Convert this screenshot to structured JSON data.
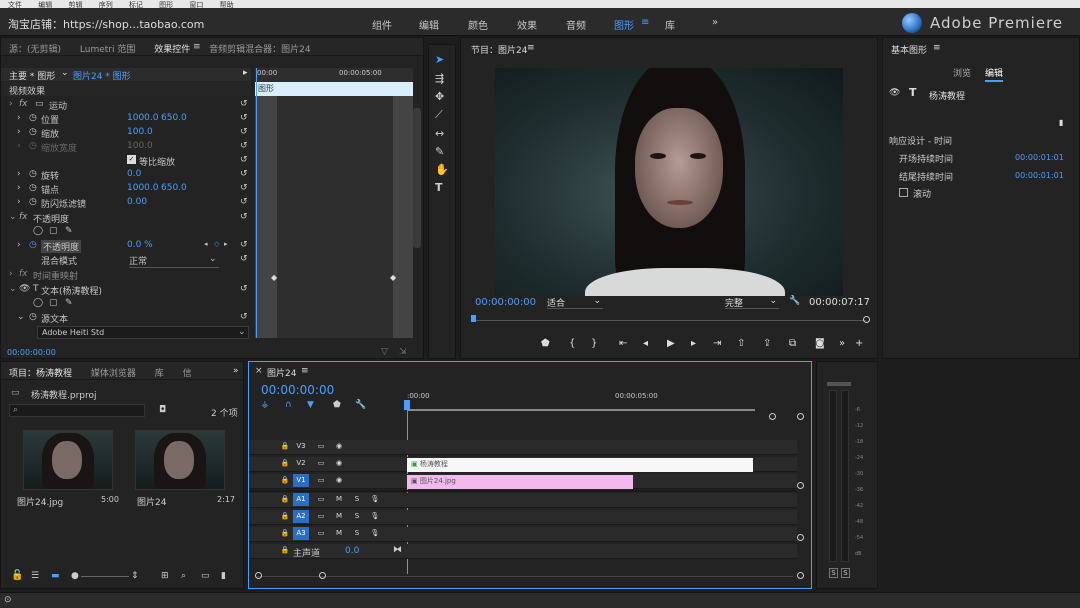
{
  "menubar": [
    "文件",
    "编辑",
    "剪辑",
    "序列",
    "标记",
    "图形",
    "窗口",
    "帮助"
  ],
  "topbar": {
    "shop_label": "淘宝店铺：https://shop...taobao.com",
    "workspaces": [
      {
        "label": "组件",
        "active": false
      },
      {
        "label": "编辑",
        "active": false
      },
      {
        "label": "颜色",
        "active": false
      },
      {
        "label": "效果",
        "active": false
      },
      {
        "label": "音频",
        "active": false
      },
      {
        "label": "图形",
        "active": true
      },
      {
        "label": "库",
        "active": false
      }
    ],
    "more": "»",
    "menu_icon": "≡",
    "logo_text": "Adobe Premiere"
  },
  "source_panel": {
    "tabs": [
      "源：(无剪辑)",
      "Lumetri 范围",
      "效果控件",
      "音频剪辑混合器：图片24"
    ],
    "active_tab": "效果控件",
    "menu_icon": "≡",
    "clip_master": "主要 * 图形",
    "clip_name": "图片24 * 图形",
    "timecode_start": "00:00",
    "timecode_end": "00:00:05:00",
    "clip_bar_label": "图形",
    "section_video": "视频效果",
    "rows": [
      {
        "label": "运动",
        "fx": true
      },
      {
        "label": "位置",
        "v1": "1000.0",
        "v2": "650.0"
      },
      {
        "label": "缩放",
        "v1": "100.0"
      },
      {
        "label": "缩放宽度",
        "v1": "100.0",
        "dim": true
      },
      {
        "label": "等比缩放",
        "checkbox": true
      },
      {
        "label": "旋转",
        "v1": "0.0"
      },
      {
        "label": "锚点",
        "v1": "1000.0",
        "v2": "650.0"
      },
      {
        "label": "防闪烁滤镜",
        "v1": "0.00"
      },
      {
        "label": "不透明度",
        "fx": true
      },
      {
        "label": "不透明度",
        "v1": "0.0 %",
        "highlight": true
      },
      {
        "label": "混合模式",
        "select": "正常"
      },
      {
        "label": "时间重映射",
        "fx": true
      },
      {
        "label": "文本(杨涛教程)",
        "fx": true
      },
      {
        "label": "源文本"
      }
    ],
    "font_select": "Adobe Heiti Std",
    "bottom_timecode": "00:00:00:00"
  },
  "program_panel": {
    "title": "节目：图片24",
    "menu_icon": "≡",
    "timecode_left": "00:00:00:00",
    "fit_select": "适合",
    "quality_select": "完整",
    "timecode_right": "00:00:07:17"
  },
  "graphics_panel": {
    "title": "基本图形",
    "menu_icon": "≡",
    "tabs": [
      "浏览",
      "编辑"
    ],
    "active_tab": "编辑",
    "layer_name": "杨涛教程",
    "responsive_title": "响应设计 - 时间",
    "intro_label": "开场持续时间",
    "intro_value": "00:00:01:01",
    "outro_label": "结尾持续时间",
    "outro_value": "00:00:01:01",
    "roll_label": "滚动"
  },
  "project_panel": {
    "tabs": [
      "项目：杨涛教程",
      "媒体浏览器",
      "库",
      "信"
    ],
    "active_tab": "项目：杨涛教程",
    "menu_icon": "≡",
    "more": "»",
    "file": "杨涛教程.prproj",
    "item_count": "2 个项",
    "items": [
      {
        "name": "图片24.jpg",
        "duration": "5:00"
      },
      {
        "name": "图片24",
        "duration": "2:17"
      }
    ]
  },
  "timeline_panel": {
    "title": "图片24",
    "close": "×",
    "menu_icon": "≡",
    "timecode": "00:00:00:00",
    "ruler_start": ":00:00",
    "ruler_mid": "00:00:05:00",
    "tracks": [
      {
        "name": "V3"
      },
      {
        "name": "V2"
      },
      {
        "name": "V1",
        "active": true
      },
      {
        "name": "A1",
        "active": true
      },
      {
        "name": "A2",
        "active": true
      },
      {
        "name": "A3",
        "active": true
      }
    ],
    "master_label": "主声道",
    "master_value": "0.0",
    "clip_text": "杨涛教程",
    "clip_image": "图片24.jpg"
  },
  "audio_meter": {
    "scale": [
      "-6",
      "-12",
      "-18",
      "-24",
      "-30",
      "-36",
      "-42",
      "-48",
      "-54",
      "dB"
    ],
    "solo": "S"
  },
  "colors": {
    "accent": "#4a9eff",
    "clip_pink": "#f3b9ef",
    "clip_white": "#f7f7f7",
    "track_blue": "#2a6fc4"
  },
  "icons": [
    "selection-tool-icon",
    "track-select-icon",
    "ripple-edit-icon",
    "razor-icon",
    "slip-icon",
    "pen-icon",
    "hand-icon",
    "type-icon"
  ]
}
